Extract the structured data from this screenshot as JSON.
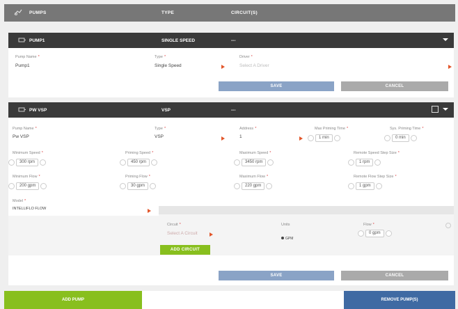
{
  "header": {
    "col_pumps": "PUMPS",
    "col_type": "TYPE",
    "col_circuits": "CIRCUIT(S)"
  },
  "pump1": {
    "name": "PUMP1",
    "type": "SINGLE SPEED",
    "circuits": "---",
    "fields": {
      "name_label": "Pump Name",
      "name_value": "Pump1",
      "type_label": "Type",
      "type_value": "Single Speed",
      "driver_label": "Driver",
      "driver_placeholder": "Select A Driver"
    },
    "save": "SAVE",
    "cancel": "CANCEL"
  },
  "pump2": {
    "name": "PW VSP",
    "type": "VSP",
    "circuits": "---",
    "fields": {
      "name_label": "Pump Name",
      "name_value": "Pw VSP",
      "type_label": "Type",
      "type_value": "VSP",
      "address_label": "Address",
      "address_value": "1",
      "max_priming_label": "Max Priming Time",
      "max_priming_value": "1 min",
      "sys_priming_label": "Sys. Priming Time",
      "sys_priming_value": "0 min",
      "min_speed_label": "Minimum Speed",
      "min_speed_value": "300 rpm",
      "priming_speed_label": "Priming Speed",
      "priming_speed_value": "450 rpm",
      "max_speed_label": "Maximum Speed",
      "max_speed_value": "3450 rpm",
      "speed_step_label": "Remote Speed Step Size",
      "speed_step_value": "1 rpm",
      "min_flow_label": "Minimum Flow",
      "min_flow_value": "200 gpm",
      "priming_flow_label": "Priming Flow",
      "priming_flow_value": "30 gpm",
      "max_flow_label": "Maximum Flow",
      "max_flow_value": "220 gpm",
      "flow_step_label": "Remote Flow Step Size",
      "flow_step_value": "1 gpm",
      "model_label": "Model",
      "model_value": "INTELLIFLO FLOW",
      "circuit_label": "Circuit",
      "circuit_placeholder": "Select A Circuit",
      "units_label": "Units",
      "units_value": "GPM",
      "flow_label": "Flow",
      "flow_value": "0 gpm"
    },
    "add_circuit": "ADD CIRCUIT",
    "save": "SAVE",
    "cancel": "CANCEL"
  },
  "footer": {
    "add_pump": "ADD PUMP",
    "remove_pumps": "REMOVE PUMP(S)"
  },
  "colors": {
    "header_gray": "#777777",
    "panel_dark": "#3a3a3a",
    "save_blue": "#8aa3c6",
    "cancel_gray": "#aaaaaa",
    "green": "#88bf1e",
    "remove_blue": "#3f6aa3",
    "arrow_orange": "#e2562a"
  },
  "icons": {
    "header": "pump-icon",
    "pump_row": "pump-icon",
    "chevron": "chevron-down-icon",
    "dropdown": "caret-right-icon"
  }
}
